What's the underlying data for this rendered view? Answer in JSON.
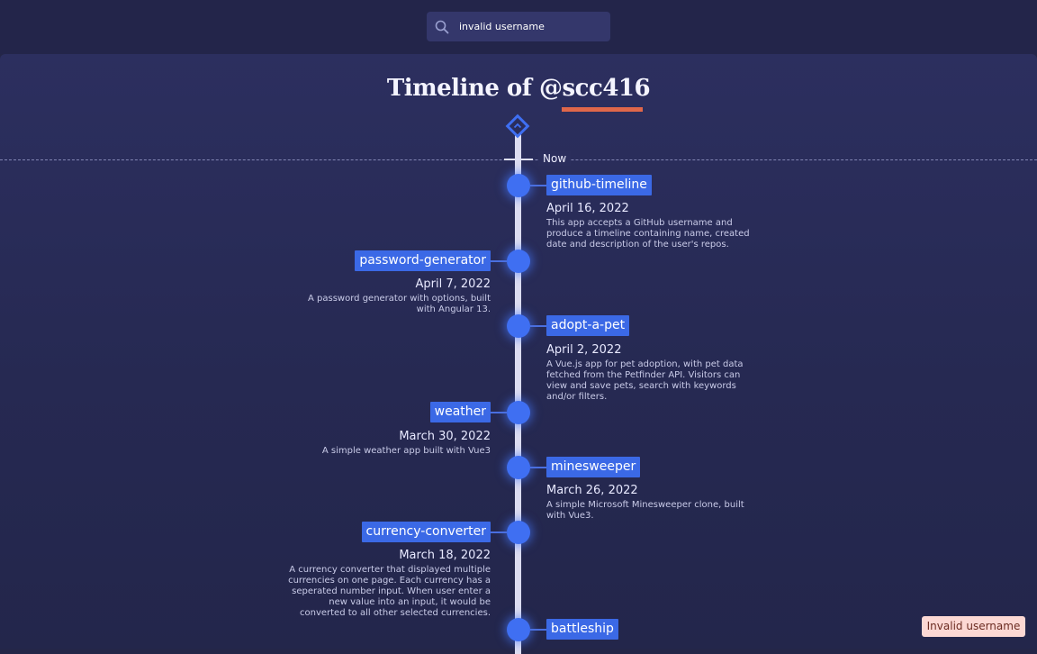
{
  "search": {
    "value": "invalid username"
  },
  "title": {
    "prefix": "Timeline of ",
    "handle": "@scc416"
  },
  "now_label": "Now",
  "entries": [
    {
      "name": "github-timeline",
      "date": "April 16, 2022",
      "description": "This app accepts a GitHub username and produce a timeline containing name, created date and description of the user's repos."
    },
    {
      "name": "password-generator",
      "date": "April 7, 2022",
      "description": "A password generator with options, built with Angular 13."
    },
    {
      "name": "adopt-a-pet",
      "date": "April 2, 2022",
      "description": "A Vue.js app for pet adoption, with pet data fetched from the Petfinder API. Visitors can view and save pets, search with keywords and/or filters."
    },
    {
      "name": "weather",
      "date": "March 30, 2022",
      "description": "A simple weather app built with Vue3"
    },
    {
      "name": "minesweeper",
      "date": "March 26, 2022",
      "description": "A simple Microsoft Minesweeper clone, built with Vue3."
    },
    {
      "name": "currency-converter",
      "date": "March 18, 2022",
      "description": "A currency converter that displayed multiple currencies on one page. Each currency has a seperated number input. When user enter a new value into an input, it would be converted to all other selected currencies."
    },
    {
      "name": "battleship"
    }
  ],
  "toast": "Invalid username",
  "colors": {
    "accent": "#3b69e6",
    "underline": "#e0674a",
    "toast_bg": "#fcd8d4"
  }
}
